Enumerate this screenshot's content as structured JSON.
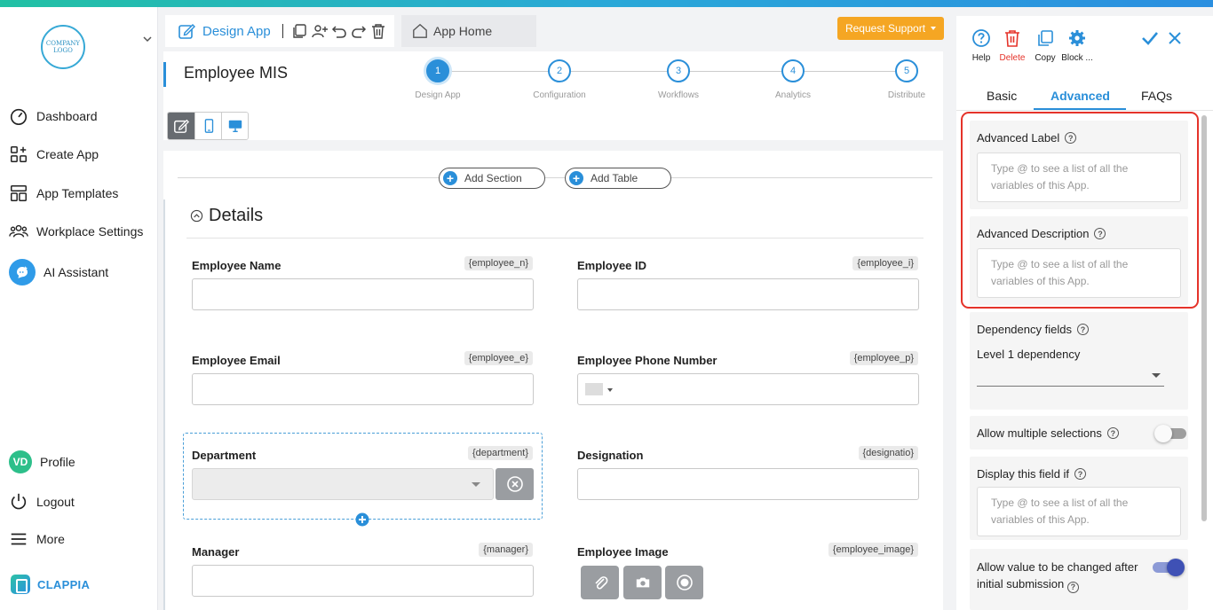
{
  "brand": {
    "logo_text": "COMPANY LOGO",
    "name": "CLAPPIA",
    "colors": {
      "primary": "#2a8fd9",
      "accent": "#f5a623",
      "danger": "#e5332a",
      "toggle_on": "#3f51b5"
    }
  },
  "sidebar": {
    "items": [
      {
        "label": "Dashboard",
        "icon": "gauge-icon"
      },
      {
        "label": "Create App",
        "icon": "grid-plus-icon"
      },
      {
        "label": "App Templates",
        "icon": "templates-icon"
      },
      {
        "label": "Workplace Settings",
        "icon": "people-icon"
      },
      {
        "label": "AI Assistant",
        "icon": "ai-assistant-icon"
      }
    ],
    "bottom": [
      {
        "label": "Profile",
        "avatar": "VD"
      },
      {
        "label": "Logout",
        "icon": "power-icon"
      },
      {
        "label": "More",
        "icon": "menu-icon"
      }
    ]
  },
  "toolbar": {
    "design_tab": "Design App",
    "home_tab": "App Home",
    "support_btn": "Request Support"
  },
  "app": {
    "title": "Employee MIS",
    "steps": [
      {
        "num": "1",
        "label": "Design App",
        "active": true
      },
      {
        "num": "2",
        "label": "Configuration",
        "active": false
      },
      {
        "num": "3",
        "label": "Workflows",
        "active": false
      },
      {
        "num": "4",
        "label": "Analytics",
        "active": false
      },
      {
        "num": "5",
        "label": "Distribute",
        "active": false
      }
    ]
  },
  "canvas": {
    "add_section": "Add Section",
    "add_table": "Add Table",
    "section_title": "Details",
    "fields": [
      {
        "label": "Employee Name",
        "tag": "{employee_n}",
        "type": "text"
      },
      {
        "label": "Employee ID",
        "tag": "{employee_i}",
        "type": "text"
      },
      {
        "label": "Employee Email",
        "tag": "{employee_e}",
        "type": "text"
      },
      {
        "label": "Employee Phone Number",
        "tag": "{employee_p}",
        "type": "phone"
      },
      {
        "label": "Department",
        "tag": "{department}",
        "type": "select"
      },
      {
        "label": "Designation",
        "tag": "{designatio}",
        "type": "text"
      },
      {
        "label": "Manager",
        "tag": "{manager}",
        "type": "text"
      },
      {
        "label": "Employee Image",
        "tag": "{employee_image}",
        "type": "media"
      }
    ]
  },
  "panel": {
    "actions": [
      {
        "label": "Help",
        "icon": "help-icon"
      },
      {
        "label": "Delete",
        "icon": "trash-icon"
      },
      {
        "label": "Copy",
        "icon": "copy-icon"
      },
      {
        "label": "Block ...",
        "icon": "gear-icon"
      }
    ],
    "tabs": [
      "Basic",
      "Advanced",
      "FAQs"
    ],
    "active_tab": "Advanced",
    "advanced_label": {
      "title": "Advanced Label",
      "placeholder": "Type @ to see a list of all the variables of this App."
    },
    "advanced_desc": {
      "title": "Advanced Description",
      "placeholder": "Type @ to see a list of all the variables of this App."
    },
    "dependency": {
      "title": "Dependency fields",
      "level_label": "Level 1 dependency"
    },
    "allow_multiple": {
      "title": "Allow multiple selections",
      "on": false
    },
    "display_if": {
      "title": "Display this field if",
      "placeholder": "Type @ to see a list of all the variables of this App."
    },
    "allow_change": {
      "title": "Allow value to be changed after initial submission",
      "on": true
    }
  }
}
